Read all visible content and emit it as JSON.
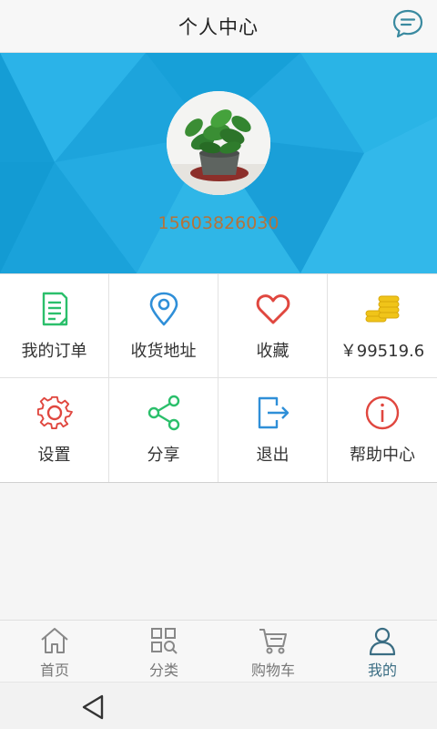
{
  "header": {
    "title": "个人中心",
    "message_icon": "chat-bubble-icon"
  },
  "profile": {
    "phone": "15603826030",
    "avatar_icon": "potted-plant-avatar"
  },
  "grid": [
    {
      "label": "我的订单",
      "icon": "order-document-icon",
      "color": "#2bbf6b"
    },
    {
      "label": "收货地址",
      "icon": "location-pin-icon",
      "color": "#2f8fd8"
    },
    {
      "label": "收藏",
      "icon": "heart-icon",
      "color": "#e0473f"
    },
    {
      "label": "￥99519.6",
      "icon": "coins-icon",
      "color": "#f0c419"
    },
    {
      "label": "设置",
      "icon": "gear-icon",
      "color": "#e0473f"
    },
    {
      "label": "分享",
      "icon": "share-icon",
      "color": "#2bbf6b"
    },
    {
      "label": "退出",
      "icon": "logout-icon",
      "color": "#2f8fd8"
    },
    {
      "label": "帮助中心",
      "icon": "info-circle-icon",
      "color": "#e0473f"
    }
  ],
  "tabs": [
    {
      "label": "首页",
      "icon": "home-icon",
      "active": false
    },
    {
      "label": "分类",
      "icon": "category-search-icon",
      "active": false
    },
    {
      "label": "购物车",
      "icon": "cart-icon",
      "active": false
    },
    {
      "label": "我的",
      "icon": "user-icon",
      "active": true
    }
  ],
  "colors": {
    "banner_blue": "#1fa7df",
    "phone_text": "#b5733a",
    "active_tab": "#3a6d83"
  }
}
